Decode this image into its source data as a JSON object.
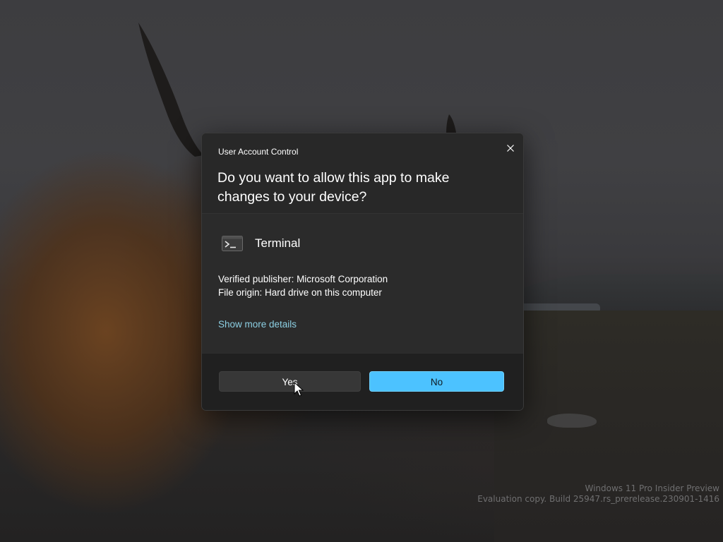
{
  "dialog": {
    "caption": "User Account Control",
    "question": "Do you want to allow this app to make changes to your device?",
    "app": {
      "name": "Terminal",
      "icon": "terminal-icon"
    },
    "publisher_line": "Verified publisher: Microsoft Corporation",
    "origin_line": "File origin: Hard drive on this computer",
    "more_details": "Show more details",
    "yes_label": "Yes",
    "no_label": "No",
    "close_icon": "close-icon"
  },
  "watermark": {
    "line1": "Windows 11 Pro Insider Preview",
    "line2": "Evaluation copy. Build 25947.rs_prerelease.230901-1416"
  },
  "colors": {
    "dialog_bg": "#282828",
    "footer_bg": "#202020",
    "accent": "#4cc2ff",
    "link": "#8ccfe3"
  }
}
